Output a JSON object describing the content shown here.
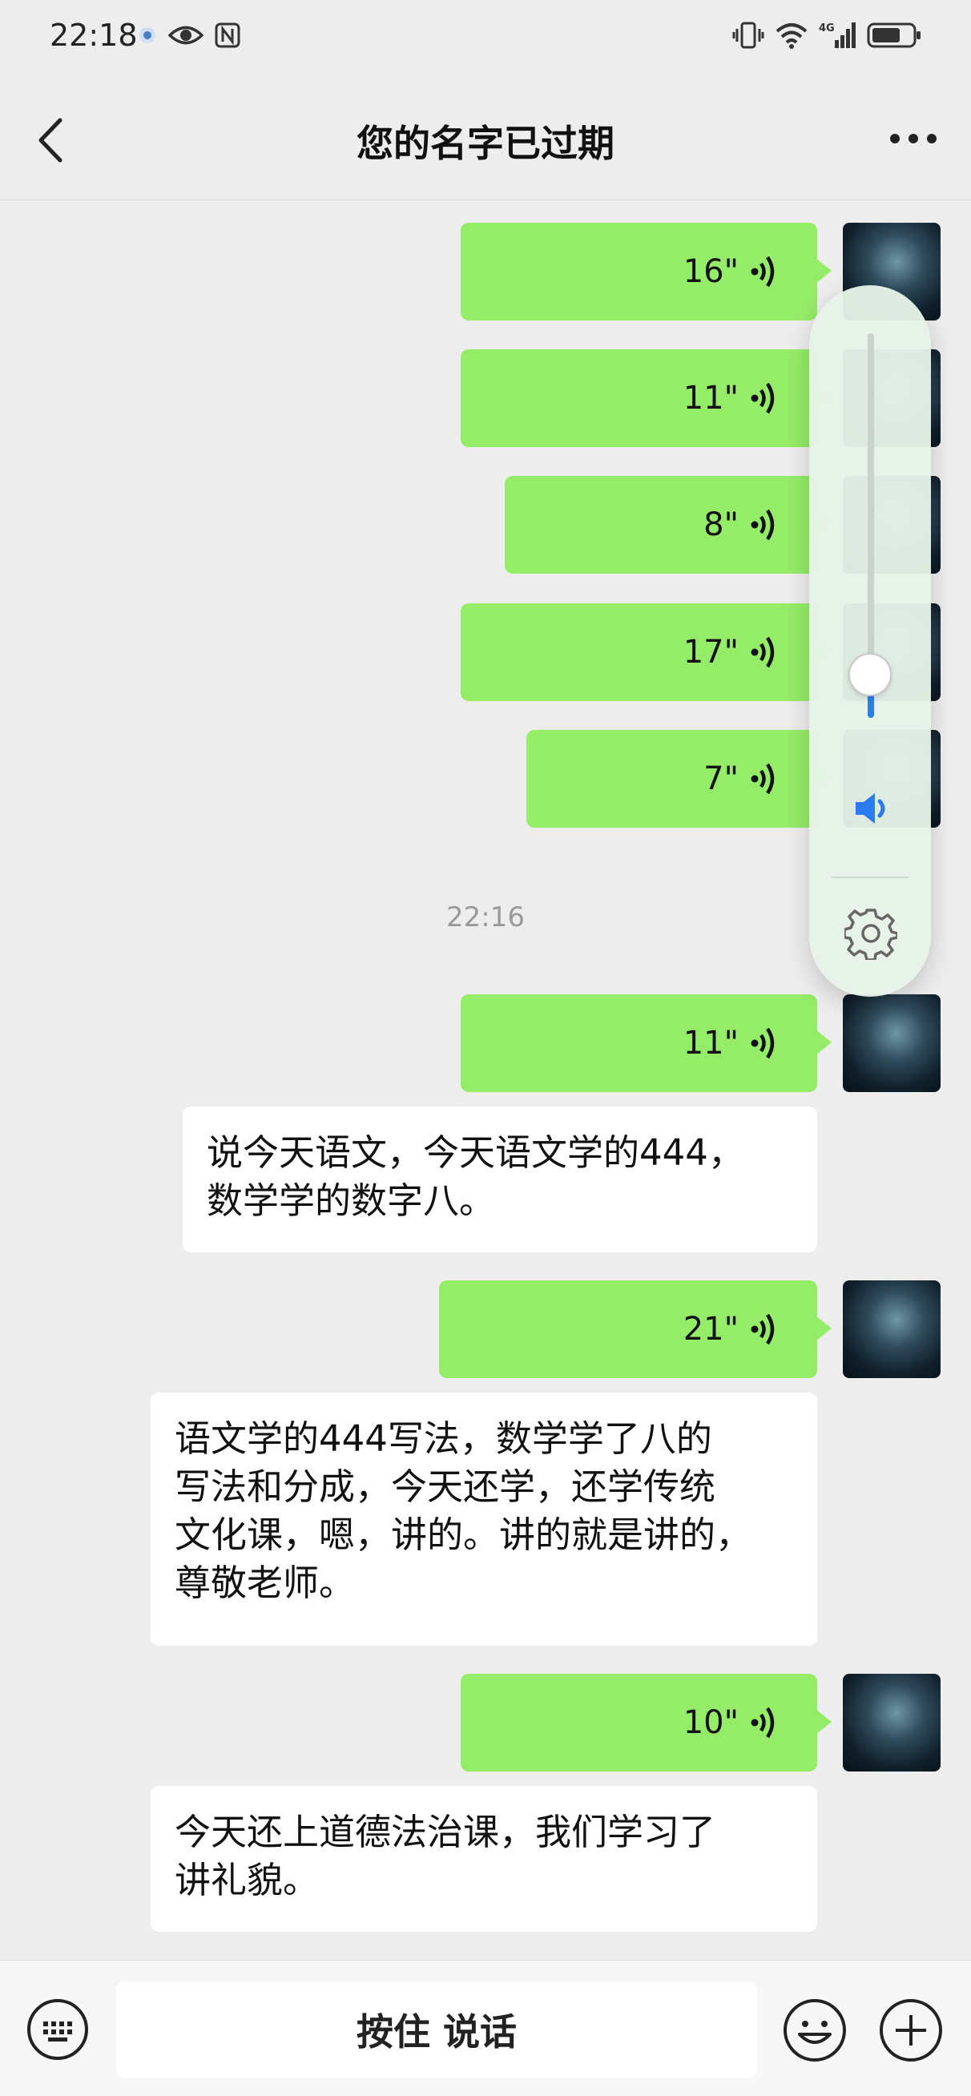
{
  "status_bar": {
    "time": "22:18",
    "left_icons": [
      "app-notification-icon",
      "eye-icon",
      "nfc-icon"
    ],
    "right_icons": [
      "vibrate-icon",
      "wifi-icon",
      "4g-signal-icon",
      "battery-icon"
    ],
    "network_label": "4G"
  },
  "header": {
    "title": "您的名字已过期",
    "back_icon": "chevron-left-icon",
    "more_icon": "more-dots-icon"
  },
  "messages": [
    {
      "type": "voice",
      "duration": "16\""
    },
    {
      "type": "voice",
      "duration": "11\""
    },
    {
      "type": "voice",
      "duration": "8\""
    },
    {
      "type": "voice",
      "duration": "17\""
    },
    {
      "type": "voice",
      "duration": "7\""
    },
    {
      "type": "time",
      "text": "22:16"
    },
    {
      "type": "voice",
      "duration": "11\""
    },
    {
      "type": "transcript",
      "lines": [
        "说今天语文，今天语文学的444，",
        "数学学的数字八。"
      ]
    },
    {
      "type": "voice",
      "duration": "21\""
    },
    {
      "type": "transcript",
      "lines": [
        "语文学的444写法，数学学了八的",
        "写法和分成，今天还学，还学传统",
        "文化课，嗯，讲的。讲的就是讲的，",
        "尊敬老师。"
      ]
    },
    {
      "type": "voice",
      "duration": "10\""
    },
    {
      "type": "transcript",
      "lines": [
        "今天还上道德法治课，我们学习了",
        "讲礼貌。"
      ]
    }
  ],
  "volume_panel": {
    "level": 0.05,
    "accent_color": "#2c7bf2",
    "speaker_icon": "speaker-icon",
    "settings_icon": "gear-icon"
  },
  "input_bar": {
    "hold_to_talk_label": "按住 说话",
    "keyboard_icon": "keyboard-icon",
    "emoji_icon": "emoji-icon",
    "plus_icon": "plus-icon"
  },
  "colors": {
    "background": "#ededed",
    "voice_bubble": "#95ec69",
    "transcript_bubble": "#ffffff"
  }
}
